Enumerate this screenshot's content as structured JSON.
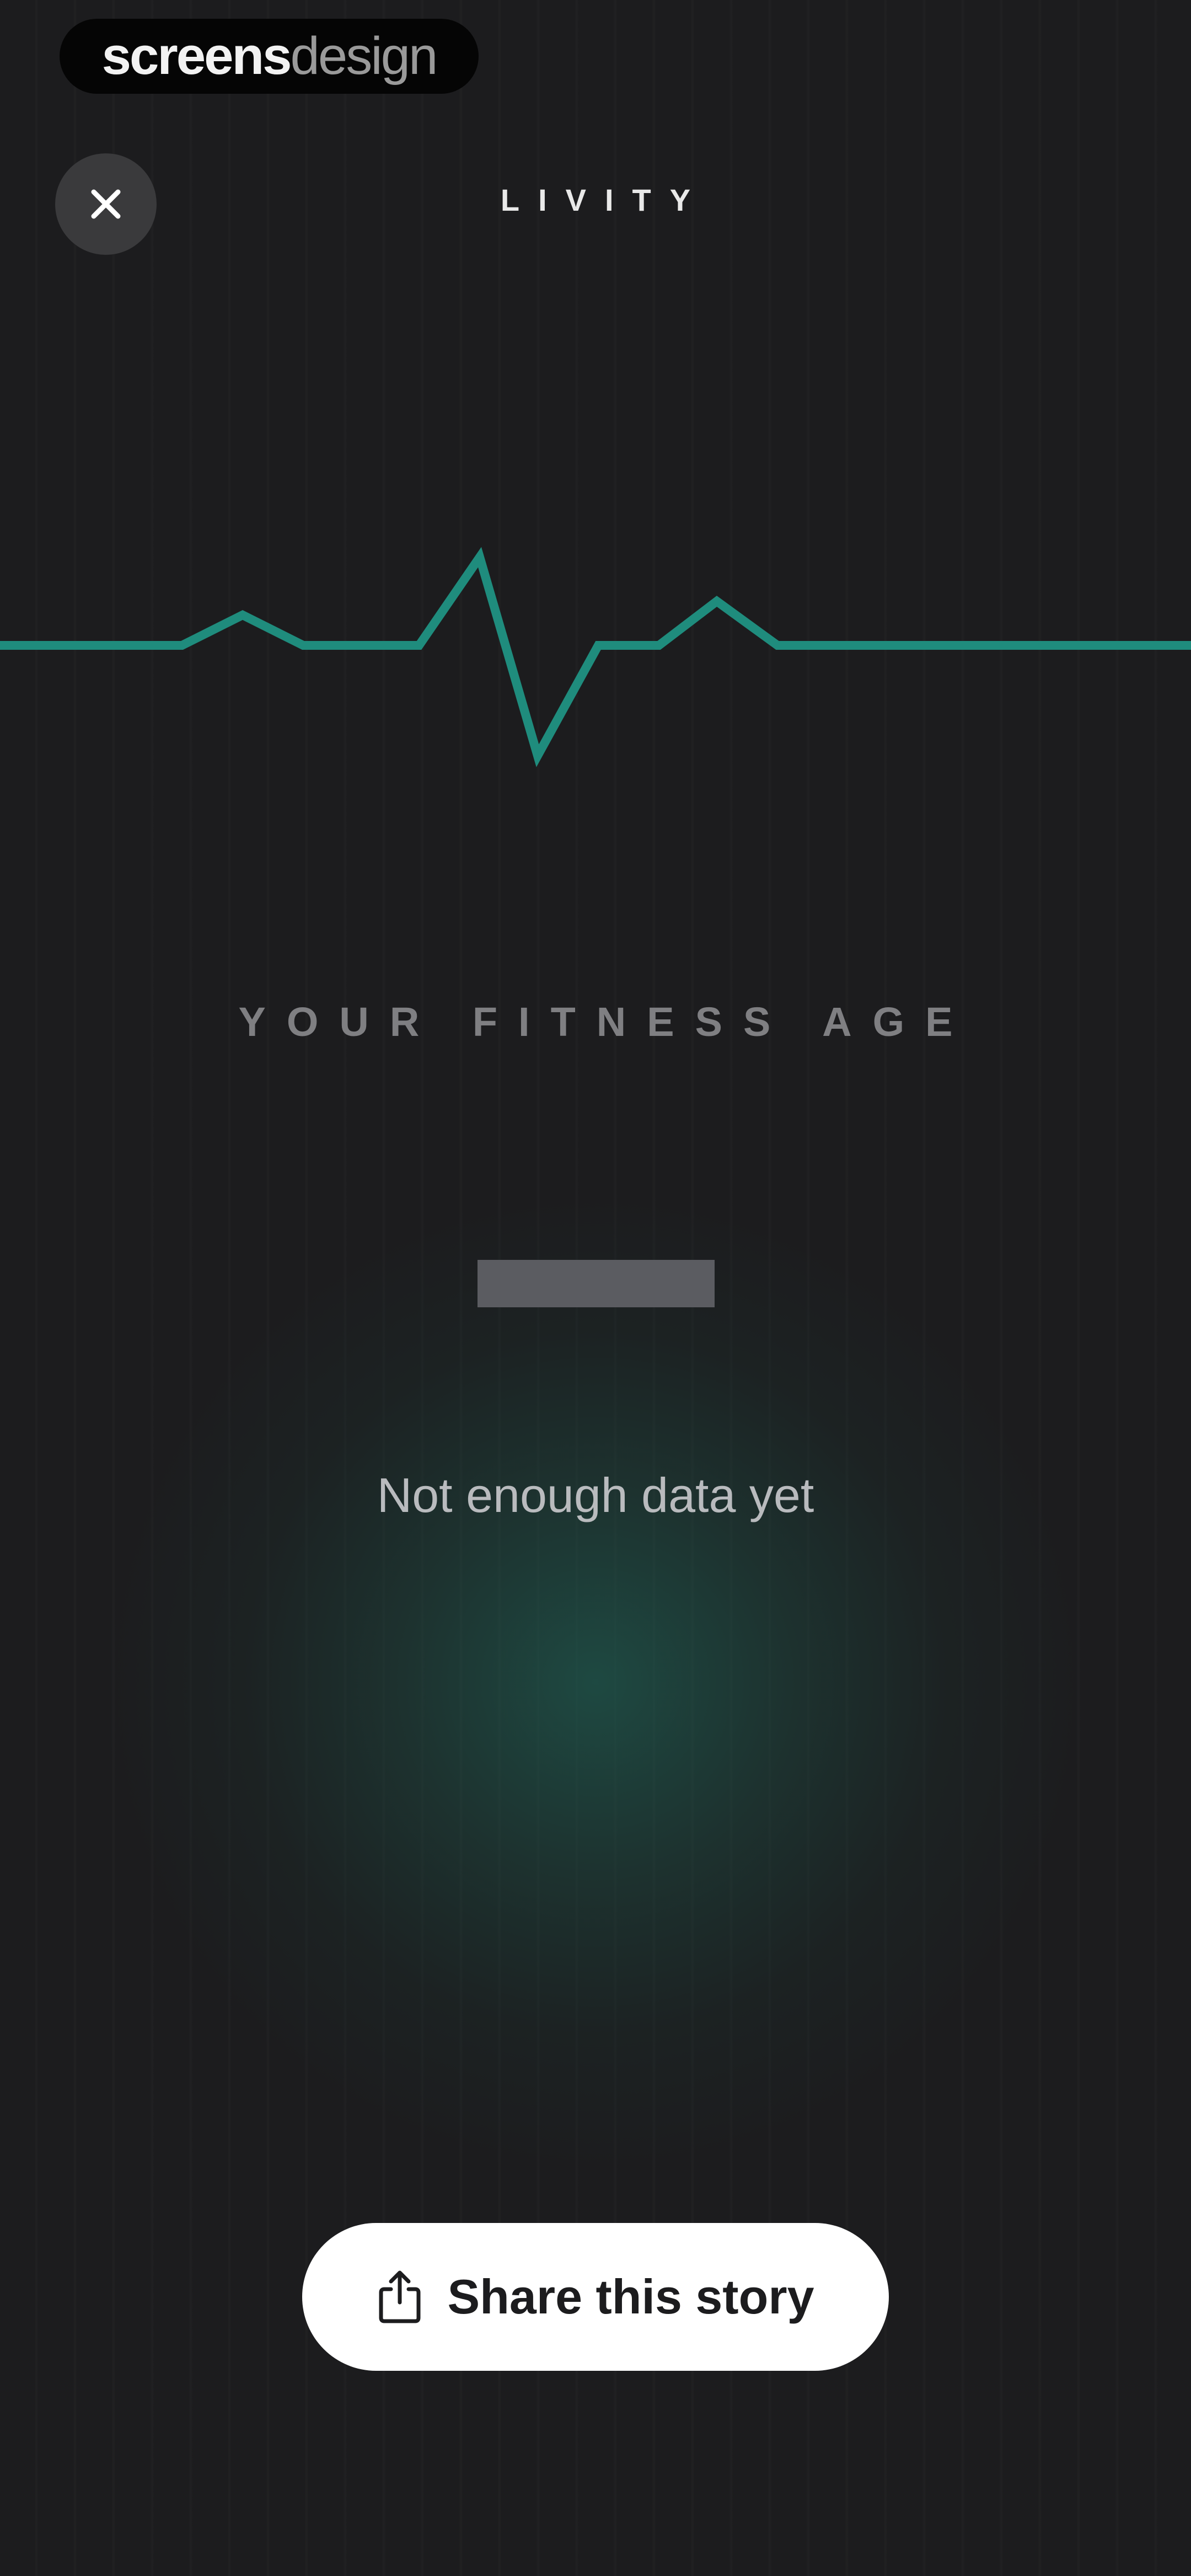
{
  "watermark": {
    "part1": "screens",
    "part2": "design"
  },
  "header": {
    "title": "LIVITY",
    "close_icon": "close-icon"
  },
  "pulse": {
    "icon": "heartbeat-line",
    "color": "#1f8c7d"
  },
  "fitness": {
    "label": "YOUR FITNESS AGE",
    "status": "Not enough data yet"
  },
  "share": {
    "label": "Share this story",
    "icon": "share-icon"
  },
  "colors": {
    "background": "#1c1c1e",
    "accent": "#1f8c7d",
    "button": "#ffffff"
  }
}
